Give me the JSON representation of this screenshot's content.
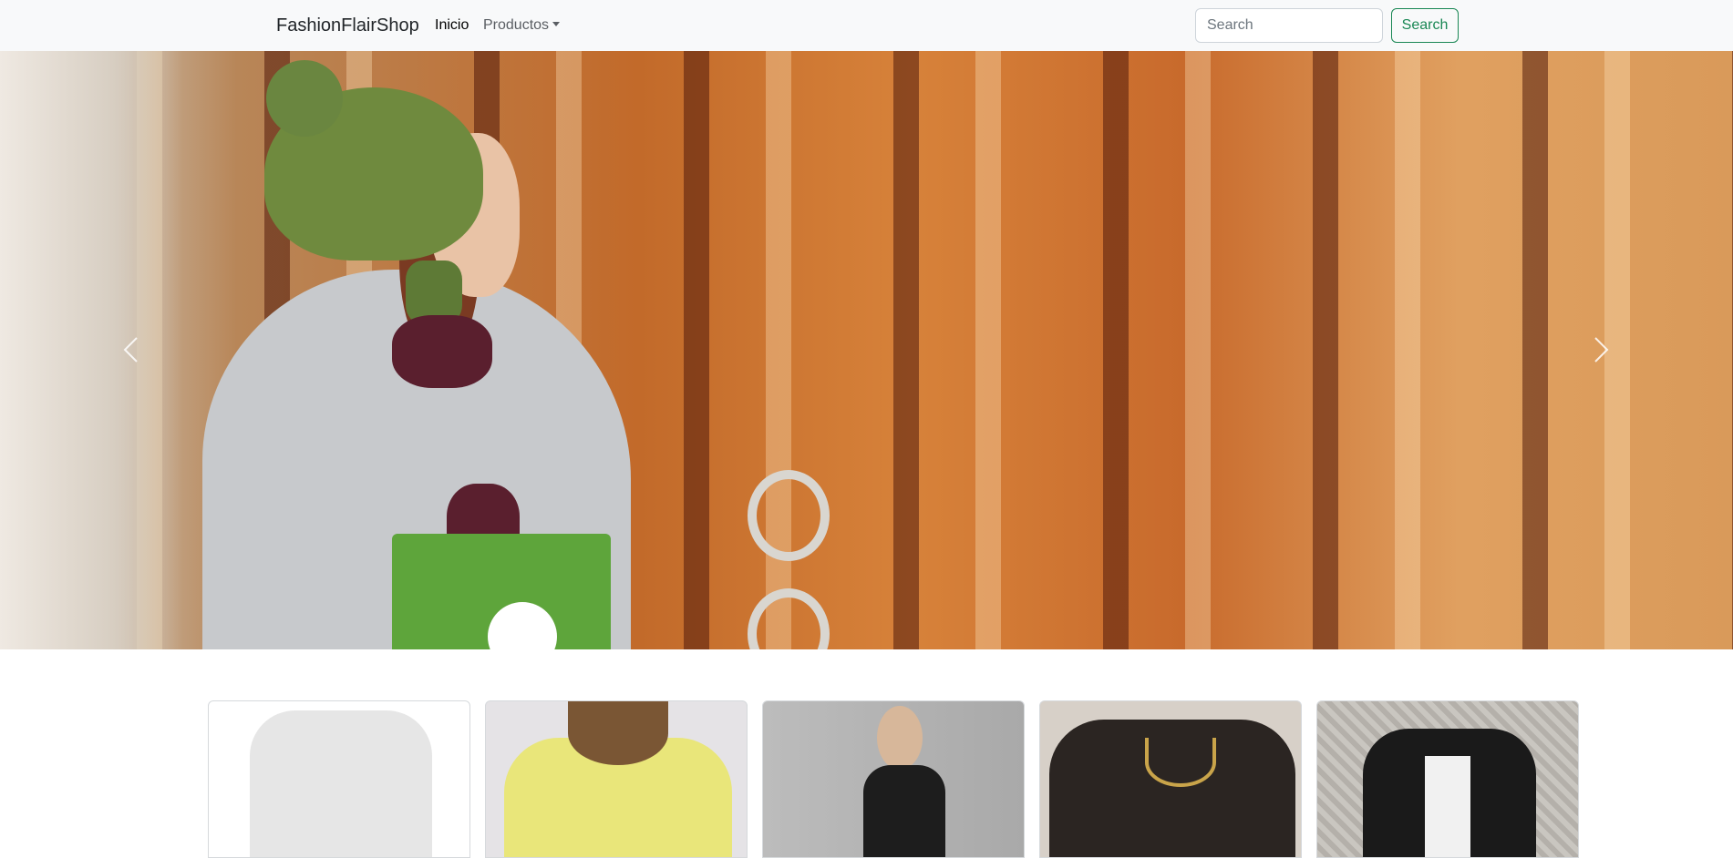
{
  "navbar": {
    "brand": "FashionFlairShop",
    "links": [
      {
        "label": "Inicio",
        "active": true
      },
      {
        "label": "Productos",
        "dropdown": true
      }
    ],
    "search": {
      "placeholder": "Search",
      "value": "",
      "button_label": "Search"
    }
  },
  "carousel": {
    "prev_icon": "chevron-left-icon",
    "next_icon": "chevron-right-icon"
  },
  "products": [
    {
      "image": "white-t-shirt"
    },
    {
      "image": "yellow-sweater"
    },
    {
      "image": "black-puffer-vest"
    },
    {
      "image": "black-leather-jacket-women"
    },
    {
      "image": "black-leather-jacket-men"
    }
  ],
  "colors": {
    "navbar_bg": "#f8f9fa",
    "accent_green": "#198754",
    "text_dark": "#212529",
    "text_muted": "#5a5e63"
  }
}
